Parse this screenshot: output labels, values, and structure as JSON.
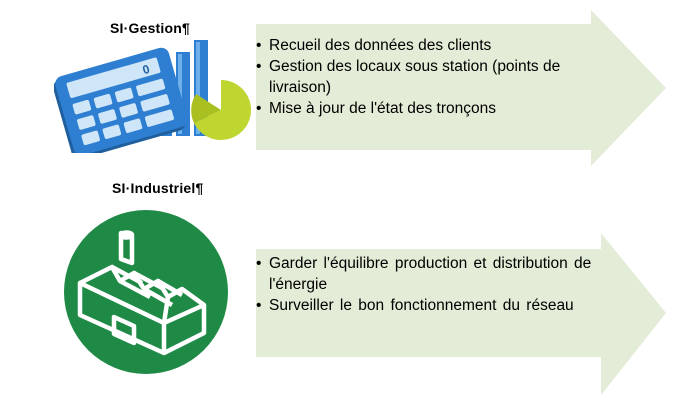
{
  "sections": [
    {
      "title": "SI·Gestion¶",
      "icon": "calculator-chart-icon",
      "items": [
        "Recueil des données des clients",
        "Gestion des locaux sous station (points de livraison)",
        "Mise à jour de l'état des tronçons"
      ]
    },
    {
      "title": "SI·Industriel¶",
      "icon": "factory-icon",
      "items": [
        "Garder l'équilibre production et distribution de l'énergie",
        "Surveiller le bon fonctionnement du réseau"
      ]
    }
  ],
  "colors": {
    "arrow_fill": "#e3ecd6",
    "calculator_blue": "#2e7fd1",
    "calculator_dark": "#1f5f9e",
    "key_light": "#cfe6f8",
    "pie_green": "#bfd630",
    "factory_green": "#1f8a45"
  }
}
